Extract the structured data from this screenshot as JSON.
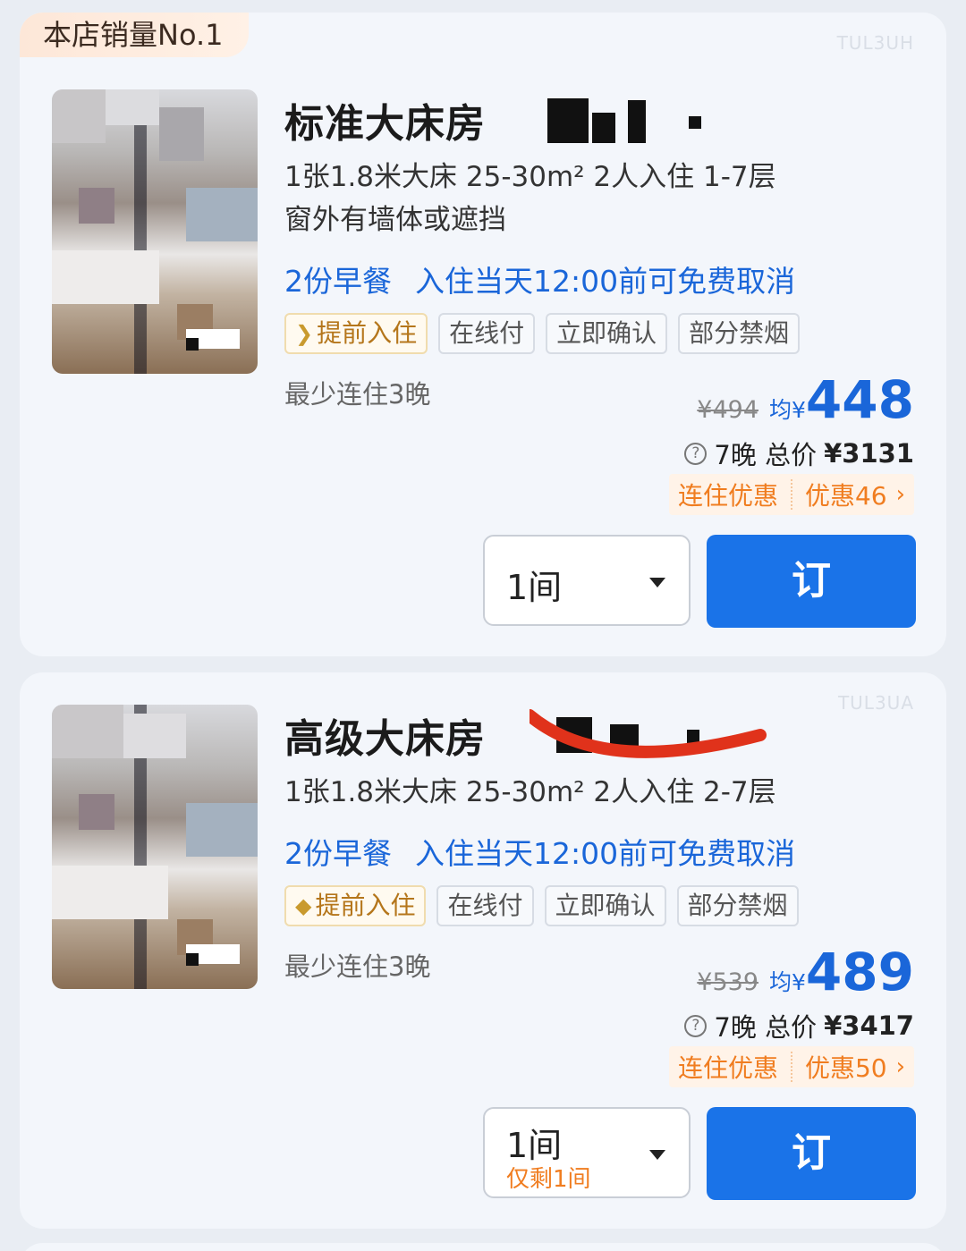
{
  "rooms": [
    {
      "badge": "本店销量No.1",
      "code": "TUL3UH",
      "name": "标准大床房",
      "specs_line1": "1张1.8米大床  25-30m²  2人入住  1-7层",
      "specs_line2": "窗外有墙体或遮挡",
      "breakfast": "2份早餐",
      "cancel": "入住当天12:00前可免费取消",
      "tags": [
        "提前入住",
        "在线付",
        "立即确认",
        "部分禁烟"
      ],
      "min_stay": "最少连住3晚",
      "original_price": "¥494",
      "avg_prefix": "均¥",
      "avg_price": "448",
      "total_label": "7晚 总价",
      "total_price": "¥3131",
      "discount_label": "连住优惠",
      "discount_amount": "优惠46",
      "quantity": "1间",
      "remaining": "",
      "book_label": "订"
    },
    {
      "badge": "",
      "code": "TUL3UA",
      "name": "高级大床房",
      "specs_line1": "1张1.8米大床  25-30m²  2人入住  2-7层",
      "specs_line2": "",
      "breakfast": "2份早餐",
      "cancel": "入住当天12:00前可免费取消",
      "tags": [
        "提前入住",
        "在线付",
        "立即确认",
        "部分禁烟"
      ],
      "min_stay": "最少连住3晚",
      "original_price": "¥539",
      "avg_prefix": "均¥",
      "avg_price": "489",
      "total_label": "7晚 总价",
      "total_price": "¥3417",
      "discount_label": "连住优惠",
      "discount_amount": "优惠50",
      "quantity": "1间",
      "remaining": "仅剩1间",
      "book_label": "订"
    }
  ],
  "icons": {
    "help": "?",
    "chevron": "›",
    "tag_icon": "diamond-icon"
  },
  "colors": {
    "accent_blue": "#1a73e8",
    "price_blue": "#1a66d9",
    "discount_orange": "#f07d20",
    "gold": "#b5761b"
  }
}
